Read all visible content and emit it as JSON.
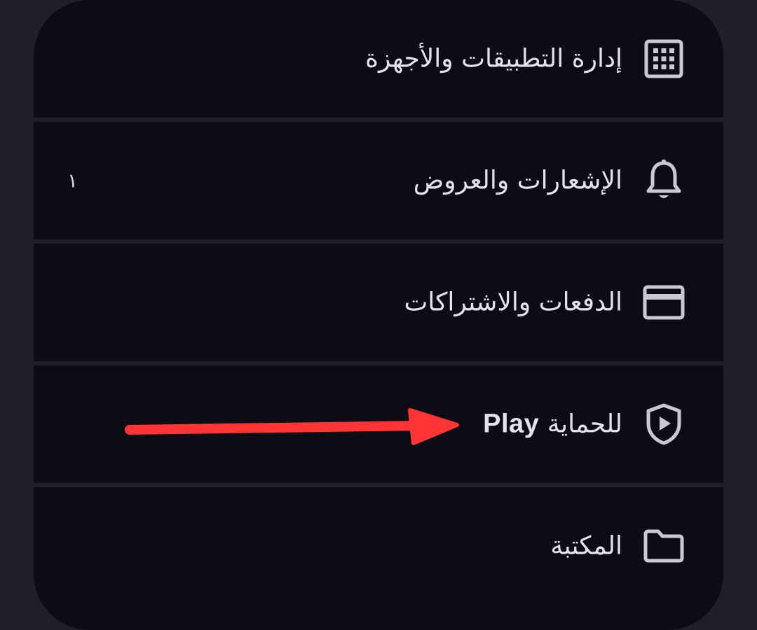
{
  "menu": {
    "items": [
      {
        "label": "إدارة التطبيقات والأجهزة",
        "icon": "grid-icon"
      },
      {
        "label": "الإشعارات والعروض",
        "icon": "bell-icon",
        "badge": "١"
      },
      {
        "label": "الدفعات والاشتراكات",
        "icon": "card-icon"
      },
      {
        "label_ar": "للحماية",
        "label_en": "Play",
        "icon": "shield-play-icon"
      },
      {
        "label": "المكتبة",
        "icon": "folder-icon"
      }
    ]
  },
  "colors": {
    "panel": "#0c0d14",
    "background": "#1e1f28",
    "text": "#e3e3ea",
    "icon": "#c9c9d4",
    "annotation_arrow": "#ff3434"
  }
}
